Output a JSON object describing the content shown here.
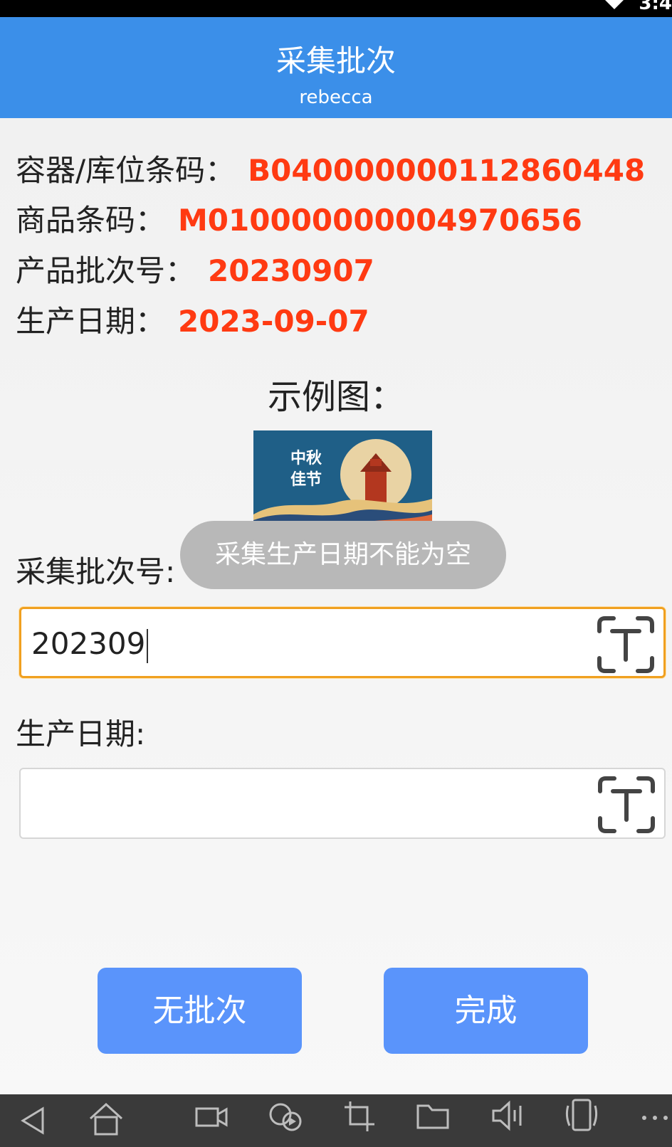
{
  "status_bar": {
    "time": "3:4"
  },
  "header": {
    "title": "采集批次",
    "subtitle": "rebecca"
  },
  "info": [
    {
      "label": "容器/库位条码：",
      "value": "B040000000112860448"
    },
    {
      "label": "商品条码：",
      "value": "M010000000004970656"
    },
    {
      "label": "产品批次号：",
      "value": "20230907"
    },
    {
      "label": "生产日期：",
      "value": "2023-09-07"
    }
  ],
  "example": {
    "label": "示例图：",
    "image_text_1": "中秋",
    "image_text_2": "佳节"
  },
  "batch_field": {
    "label": "采集批次号:",
    "value": "202309",
    "icon": "ocr-text-scan-icon"
  },
  "date_field": {
    "label": "生产日期:",
    "value": "",
    "icon": "ocr-text-scan-icon"
  },
  "toast": {
    "message": "采集生产日期不能为空"
  },
  "buttons": {
    "no_batch": "无批次",
    "done": "完成"
  },
  "nav_icons": [
    "back-icon",
    "home-icon",
    "screen-record-icon",
    "screenshot-video-icon",
    "crop-icon",
    "folder-icon",
    "volume-icon",
    "rotate-phone-icon",
    "more-icon"
  ],
  "colors": {
    "header": "#3b8fe9",
    "value_red": "#ff3a12",
    "button": "#5a94fb",
    "focus_border": "#f0a020"
  }
}
